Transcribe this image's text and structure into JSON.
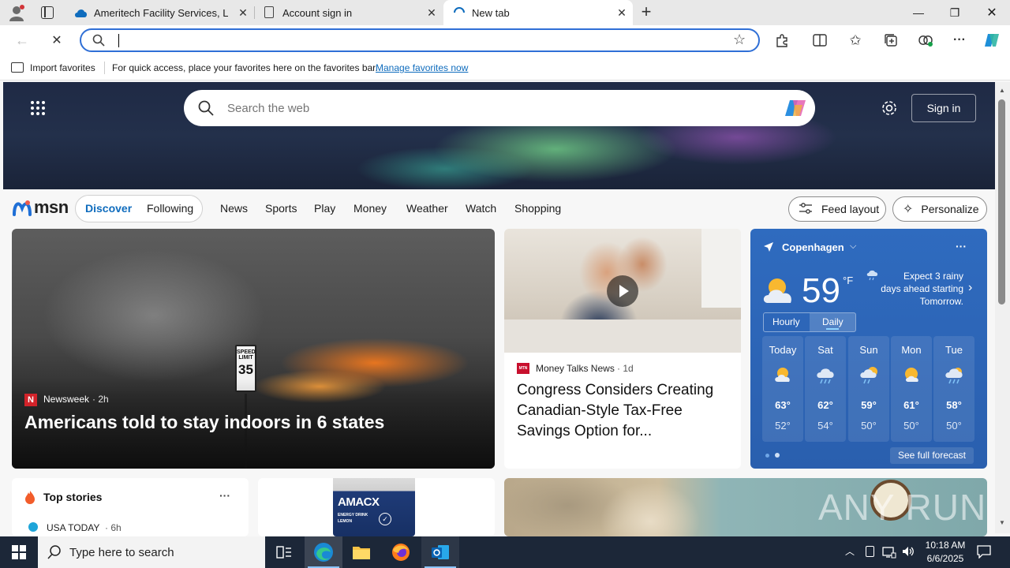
{
  "tabs": [
    {
      "title": "Ameritech Facility Services, LLC -",
      "active": false
    },
    {
      "title": "Account sign in",
      "active": false
    },
    {
      "title": "New tab",
      "active": true
    }
  ],
  "address_bar": {
    "value": "",
    "placeholder": ""
  },
  "favorites_bar": {
    "import_label": "Import favorites",
    "hint": "For quick access, place your favorites here on the favorites bar.",
    "manage_link": "Manage favorites now"
  },
  "hero": {
    "search_placeholder": "Search the web",
    "sign_in": "Sign in"
  },
  "nav": {
    "logo": "msn",
    "discover": "Discover",
    "following": "Following",
    "links": [
      "News",
      "Sports",
      "Play",
      "Money",
      "Weather",
      "Watch",
      "Shopping"
    ],
    "feed_layout": "Feed layout",
    "personalize": "Personalize"
  },
  "main_story": {
    "source": "Newsweek",
    "age": "2h",
    "headline": "Americans told to stay indoors in 6 states",
    "sign_top": "SPEED",
    "sign_mid": "LIMIT",
    "sign_num": "35"
  },
  "side_story": {
    "source": "Money Talks News",
    "source_badge": "MTN",
    "age": "1d",
    "headline": "Congress Considers Creating Canadian-Style Tax-Free Savings Option for..."
  },
  "weather": {
    "city": "Copenhagen",
    "temp": "59",
    "unit": "°F",
    "alert": "Expect 3 rainy days ahead starting Tomorrow.",
    "tab_hourly": "Hourly",
    "tab_daily": "Daily",
    "days": [
      {
        "day": "Today",
        "hi": "63°",
        "lo": "52°",
        "icon": "partly-sunny"
      },
      {
        "day": "Sat",
        "hi": "62°",
        "lo": "54°",
        "icon": "rain"
      },
      {
        "day": "Sun",
        "hi": "59°",
        "lo": "50°",
        "icon": "rain-sun"
      },
      {
        "day": "Mon",
        "hi": "61°",
        "lo": "50°",
        "icon": "partly-sunny"
      },
      {
        "day": "Tue",
        "hi": "58°",
        "lo": "50°",
        "icon": "rain"
      }
    ],
    "see_full": "See full forecast"
  },
  "top_stories": {
    "title": "Top stories",
    "first_source": "USA TODAY",
    "first_age": "6h"
  },
  "ad_card": {
    "brand": "AMACX",
    "sub": "ENERGY DRINK",
    "flavor": "LEMON"
  },
  "watermark": "ANY RUN",
  "taskbar": {
    "search_placeholder": "Type here to search",
    "time": "10:18 AM",
    "date": "6/6/2025"
  },
  "colors": {
    "accent": "#0f6cbd",
    "weather_bg": "#2a64b6",
    "taskbar": "#1c2738"
  }
}
